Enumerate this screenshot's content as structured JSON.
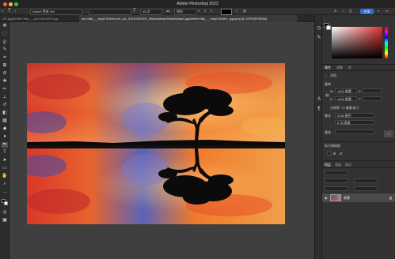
{
  "app": {
    "title": "Adobe Photoshop 2023"
  },
  "options_bar": {
    "font_family": "Adobe 黑体 Std",
    "font_style": "--",
    "font_size": "48 点",
    "aa_label": "aa",
    "aa_value": "锐利",
    "share_label": "共享"
  },
  "tabs": [
    {
      "label": "r51.jpg@refer=http___pic3.win4000.jpg",
      "active": false
    },
    {
      "label": "src=http___img9.51tietu.net_pic_2019-091300_3t5ad1jdwyn3t5ad1jdwyn.jpg&refer=http___img9.51tietu .jpg.jpeg @ 100%(RGB/8#)",
      "active": true
    }
  ],
  "panel": {
    "tabs": {
      "properties": "属性",
      "adjustments": "调整",
      "libraries": "库"
    },
    "section_title": "文档",
    "canvas_title": "画布",
    "width_label": "W",
    "width_value": "1620 像素",
    "height_label": "H",
    "height_value": "1200 像素",
    "x_label": "X",
    "y_label": "Y",
    "resolution": "分辨率: 72 像素/英寸",
    "mode_label": "模式",
    "mode_value": "RGB 颜色",
    "bit_value": "8 位/通道",
    "fill_label": "填充",
    "rulers_title": "标尺和网格",
    "layers_tabs": {
      "layers": "图层",
      "channels": "通道",
      "paths": "路径"
    },
    "layer_name": "背景"
  },
  "colors": {
    "accent": "#2d6fd6",
    "sky_orange": "#f07a2a",
    "sky_red": "#d9382a",
    "sky_blue": "#5a63b8"
  }
}
